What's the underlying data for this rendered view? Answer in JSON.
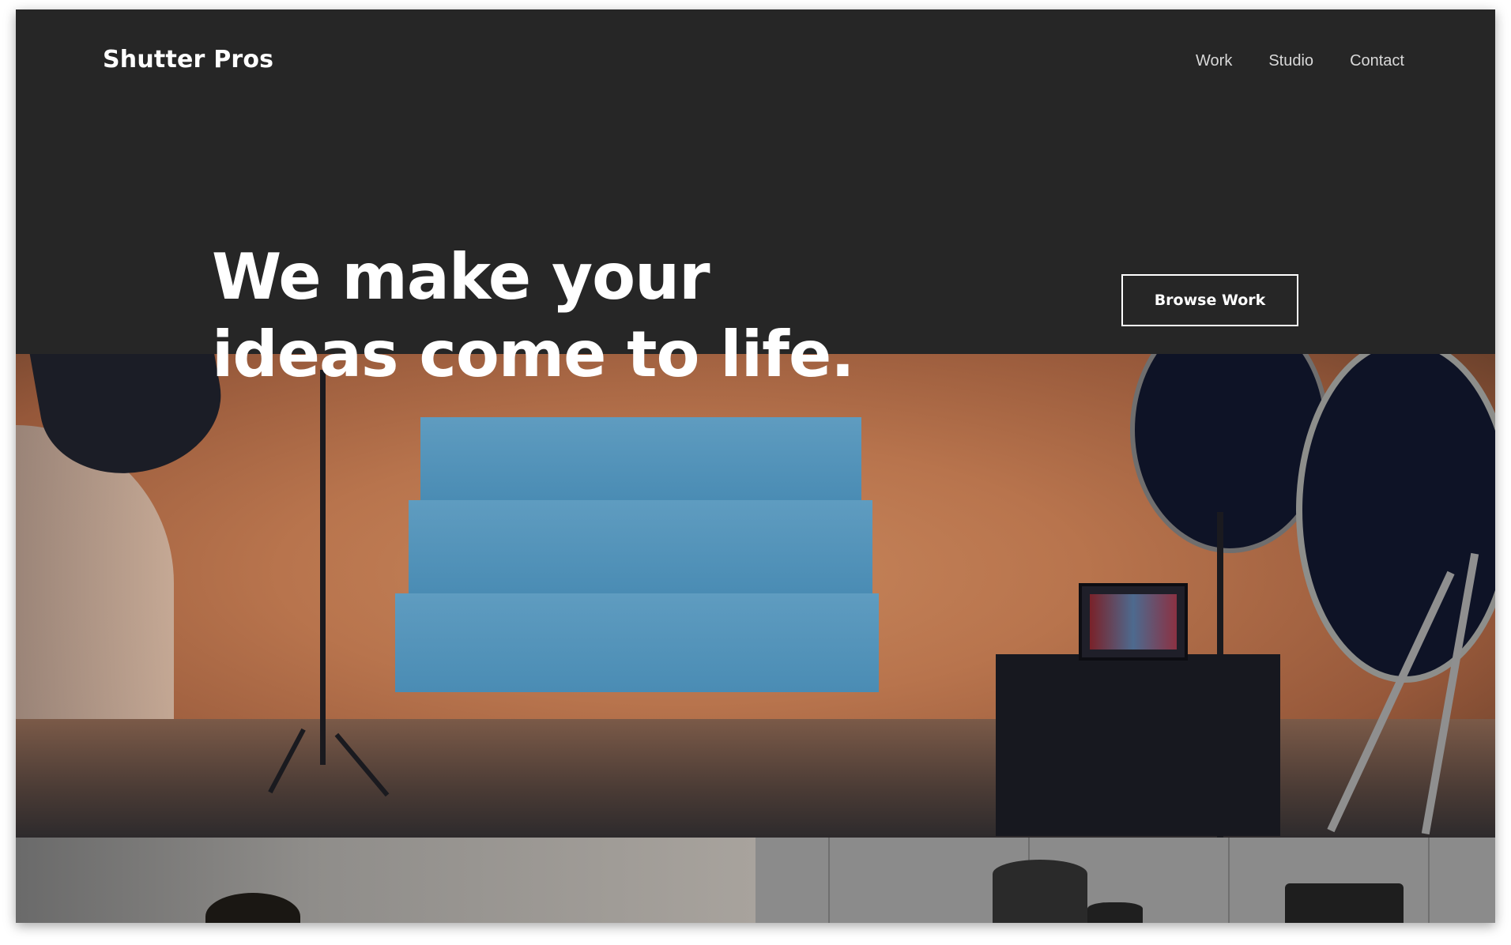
{
  "header": {
    "brand": "Shutter Pros",
    "nav": [
      {
        "label": "Work"
      },
      {
        "label": "Studio"
      },
      {
        "label": "Contact"
      }
    ]
  },
  "hero": {
    "headline_line1": "We make your",
    "headline_line2": "ideas come to life.",
    "cta_label": "Browse Work"
  },
  "colors": {
    "background": "#262626",
    "text": "#ffffff",
    "nav_text": "#d9d9d9"
  }
}
